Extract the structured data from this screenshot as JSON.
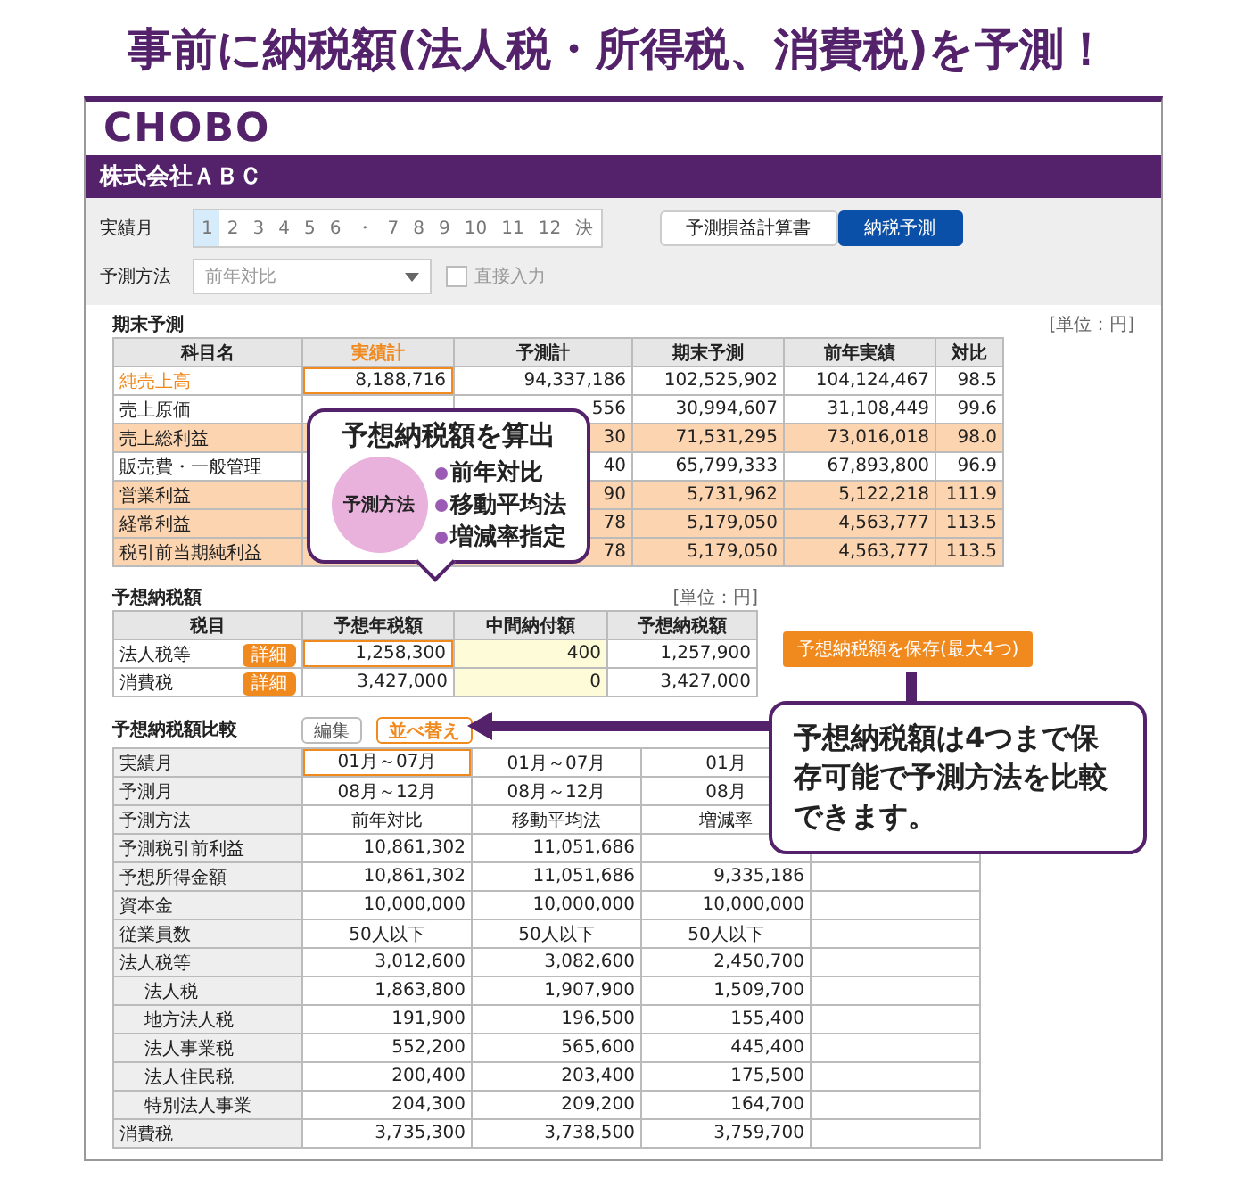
{
  "headline": "事前に納税額(法人税・所得税、消費税)を予測！",
  "app": {
    "logo": "CHOBO",
    "company": "株式会社ＡＢＣ"
  },
  "months": {
    "label": "実績月",
    "items": [
      {
        "label": "1",
        "selected": true
      },
      {
        "label": "2",
        "selected": false
      },
      {
        "label": "3",
        "selected": false
      },
      {
        "label": "4",
        "selected": false
      },
      {
        "label": "5",
        "selected": false
      },
      {
        "label": "6",
        "selected": false
      },
      {
        "label": "・",
        "selected": false
      },
      {
        "label": "7",
        "selected": false
      },
      {
        "label": "8",
        "selected": false
      },
      {
        "label": "9",
        "selected": false
      },
      {
        "label": "10",
        "selected": false
      },
      {
        "label": "11",
        "selected": false
      },
      {
        "label": "12",
        "selected": false
      },
      {
        "label": "決",
        "selected": false
      }
    ]
  },
  "view_tabs": [
    {
      "label": "予測損益計算書",
      "selected": false
    },
    {
      "label": "納税予測",
      "selected": true
    }
  ],
  "method": {
    "label": "予測方法",
    "value": "前年対比",
    "direct_input": {
      "label": "直接入力",
      "checked": false
    }
  },
  "forecast": {
    "title": "期末予測",
    "unit": "[単位：円]",
    "columns": [
      {
        "label": "科目名",
        "selected": false
      },
      {
        "label": "実績計",
        "selected": true
      },
      {
        "label": "予測計",
        "selected": false
      },
      {
        "label": "期末予測",
        "selected": false
      },
      {
        "label": "前年実績",
        "selected": false
      },
      {
        "label": "対比",
        "selected": false
      }
    ],
    "rows": [
      {
        "cells": [
          "純売上高",
          "8,188,716",
          "94,337,186",
          "102,525,902",
          "104,124,467",
          "98.5"
        ],
        "selected": true,
        "highlight": false
      },
      {
        "cells": [
          "売上原価",
          null,
          "556",
          "30,994,607",
          "31,108,449",
          "99.6"
        ],
        "selected": false,
        "highlight": false
      },
      {
        "cells": [
          "売上総利益",
          null,
          "30",
          "71,531,295",
          "73,016,018",
          "98.0"
        ],
        "selected": false,
        "highlight": true
      },
      {
        "cells": [
          "販売費・一般管理",
          null,
          "40",
          "65,799,333",
          "67,893,800",
          "96.9"
        ],
        "selected": false,
        "highlight": false
      },
      {
        "cells": [
          "営業利益",
          null,
          "90",
          "5,731,962",
          "5,122,218",
          "111.9"
        ],
        "selected": false,
        "highlight": true
      },
      {
        "cells": [
          "経常利益",
          null,
          "78",
          "5,179,050",
          "4,563,777",
          "113.5"
        ],
        "selected": false,
        "highlight": true
      },
      {
        "cells": [
          "税引前当期純利益",
          null,
          "78",
          "5,179,050",
          "4,563,777",
          "113.5"
        ],
        "selected": false,
        "highlight": true
      }
    ]
  },
  "tax": {
    "title": "予想納税額",
    "unit": "[単位：円]",
    "columns": [
      {
        "label": "税目",
        "input": false
      },
      {
        "label": "予想年税額",
        "input": false
      },
      {
        "label": "中間納付額",
        "input": true
      },
      {
        "label": "予想納税額",
        "input": false
      }
    ],
    "rows": [
      {
        "action": "詳細",
        "cells": [
          "法人税等",
          "1,258,300",
          "400",
          "1,257,900"
        ],
        "selected": true
      },
      {
        "action": "詳細",
        "cells": [
          "消費税",
          "3,427,000",
          "0",
          "3,427,000"
        ],
        "selected": false
      }
    ],
    "save_button": "予想納税額を保存(最大4つ)"
  },
  "comparison": {
    "title": "予想納税額比較",
    "buttons": [
      {
        "label": "編集",
        "kind": "plain"
      },
      {
        "label": "並べ替え",
        "kind": "accent"
      }
    ],
    "rows": [
      {
        "label": "実績月",
        "kind": "text",
        "selected": true,
        "cells": [
          "01月～07月",
          "01月～07月",
          "01月",
          null
        ]
      },
      {
        "label": "予測月",
        "kind": "text",
        "selected": false,
        "cells": [
          "08月～12月",
          "08月～12月",
          "08月",
          null
        ]
      },
      {
        "label": "予測方法",
        "kind": "text",
        "selected": false,
        "cells": [
          "前年対比",
          "移動平均法",
          "増減率",
          null
        ]
      },
      {
        "label": "予測税引前利益",
        "kind": "number",
        "selected": false,
        "cells": [
          "10,861,302",
          "11,051,686",
          null,
          null
        ]
      },
      {
        "label": "予想所得金額",
        "kind": "number",
        "selected": false,
        "cells": [
          "10,861,302",
          "11,051,686",
          "9,335,186",
          null
        ]
      },
      {
        "label": "資本金",
        "kind": "number",
        "selected": false,
        "cells": [
          "10,000,000",
          "10,000,000",
          "10,000,000",
          null
        ]
      },
      {
        "label": "従業員数",
        "kind": "text",
        "selected": false,
        "cells": [
          "50人以下",
          "50人以下",
          "50人以下",
          null
        ]
      },
      {
        "label": "法人税等",
        "kind": "number",
        "selected": false,
        "cells": [
          "3,012,600",
          "3,082,600",
          "2,450,700",
          null
        ],
        "children": [
          {
            "label": "法人税",
            "kind": "number",
            "selected": false,
            "cells": [
              "1,863,800",
              "1,907,900",
              "1,509,700",
              null
            ]
          },
          {
            "label": "地方法人税",
            "kind": "number",
            "selected": false,
            "cells": [
              "191,900",
              "196,500",
              "155,400",
              null
            ]
          },
          {
            "label": "法人事業税",
            "kind": "number",
            "selected": false,
            "cells": [
              "552,200",
              "565,600",
              "445,400",
              null
            ]
          },
          {
            "label": "法人住民税",
            "kind": "number",
            "selected": false,
            "cells": [
              "200,400",
              "203,400",
              "175,500",
              null
            ]
          },
          {
            "label": "特別法人事業",
            "kind": "number",
            "selected": false,
            "cells": [
              "204,300",
              "209,200",
              "164,700",
              null
            ]
          }
        ]
      },
      {
        "label": "消費税",
        "kind": "number",
        "selected": false,
        "cells": [
          "3,735,300",
          "3,738,500",
          "3,759,700",
          null
        ]
      }
    ]
  },
  "callouts": {
    "methods": {
      "title": "予想納税額を算出",
      "badge": "予測方法",
      "items": [
        "前年対比",
        "移動平均法",
        "増減率指定"
      ]
    },
    "save_note": "予想納税額は4つまで保存可能で予測方法を比較できます。"
  }
}
